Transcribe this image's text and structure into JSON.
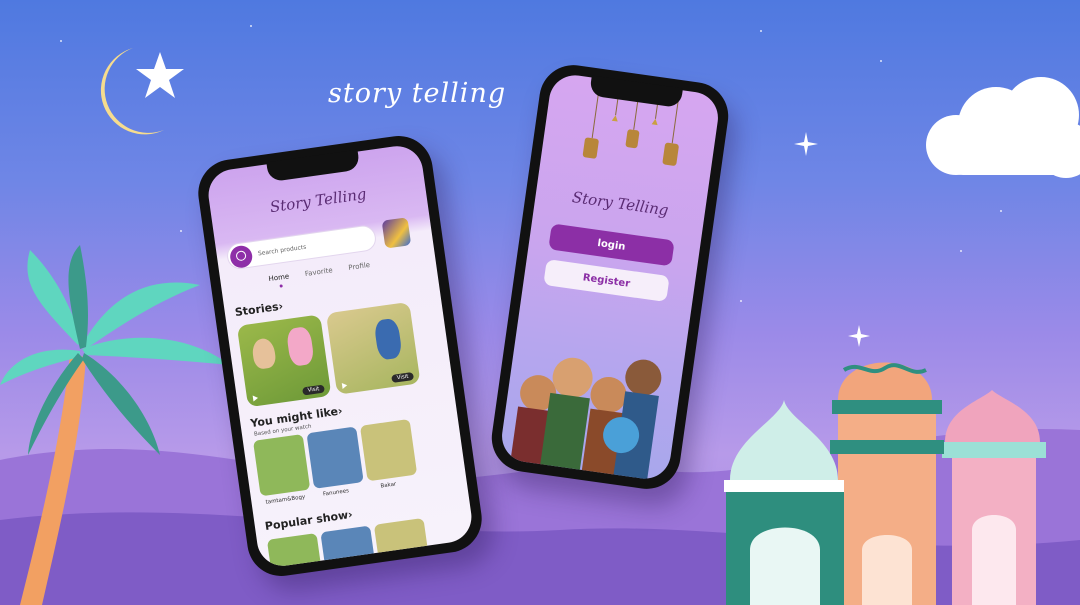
{
  "headline": "story telling",
  "left_phone": {
    "app_title": "Story Telling",
    "search_placeholder": "Search products",
    "tabs": [
      "Home",
      "Favorite",
      "Profile"
    ],
    "stories_label": "Stories",
    "visit_label": "Visit",
    "might_like_label": "You might like",
    "might_like_sub": "Based on your watch",
    "items": [
      "tamtam&Bogy",
      "Fanunees",
      "Bakar"
    ],
    "popular_label": "Popular show"
  },
  "right_phone": {
    "app_title": "Story Telling",
    "login_label": "login",
    "register_label": "Register"
  },
  "colors": {
    "accent": "#8c2fa6",
    "sky_top": "#4f79e0",
    "sky_bottom": "#b79ae9"
  },
  "icons": [
    "crescent-moon-icon",
    "star-icon",
    "search-icon",
    "play-icon",
    "lantern-icon",
    "cloud-icon",
    "palm-tree-icon",
    "mosque-icon"
  ]
}
